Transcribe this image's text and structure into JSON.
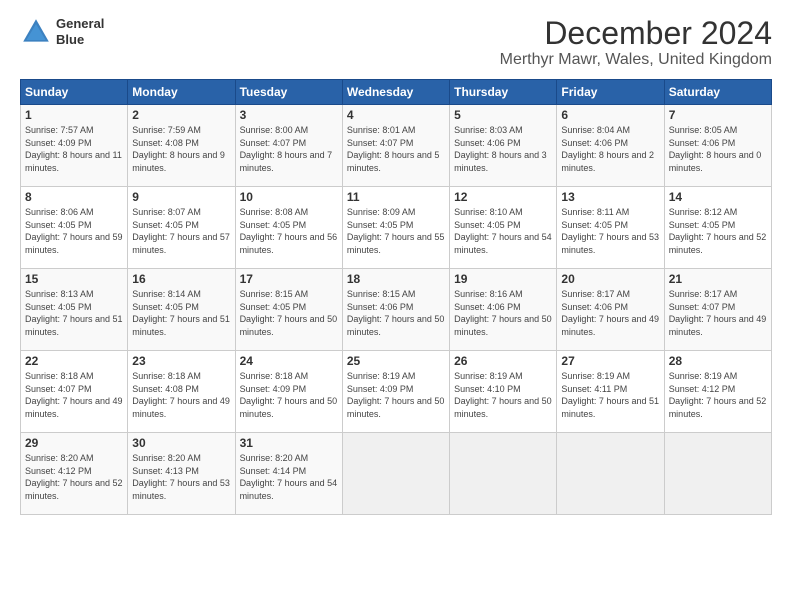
{
  "logo": {
    "line1": "General",
    "line2": "Blue"
  },
  "title": "December 2024",
  "location": "Merthyr Mawr, Wales, United Kingdom",
  "weekdays": [
    "Sunday",
    "Monday",
    "Tuesday",
    "Wednesday",
    "Thursday",
    "Friday",
    "Saturday"
  ],
  "weeks": [
    [
      {
        "day": "1",
        "sunrise": "7:57 AM",
        "sunset": "4:09 PM",
        "daylight": "8 hours and 11 minutes."
      },
      {
        "day": "2",
        "sunrise": "7:59 AM",
        "sunset": "4:08 PM",
        "daylight": "8 hours and 9 minutes."
      },
      {
        "day": "3",
        "sunrise": "8:00 AM",
        "sunset": "4:07 PM",
        "daylight": "8 hours and 7 minutes."
      },
      {
        "day": "4",
        "sunrise": "8:01 AM",
        "sunset": "4:07 PM",
        "daylight": "8 hours and 5 minutes."
      },
      {
        "day": "5",
        "sunrise": "8:03 AM",
        "sunset": "4:06 PM",
        "daylight": "8 hours and 3 minutes."
      },
      {
        "day": "6",
        "sunrise": "8:04 AM",
        "sunset": "4:06 PM",
        "daylight": "8 hours and 2 minutes."
      },
      {
        "day": "7",
        "sunrise": "8:05 AM",
        "sunset": "4:06 PM",
        "daylight": "8 hours and 0 minutes."
      }
    ],
    [
      {
        "day": "8",
        "sunrise": "8:06 AM",
        "sunset": "4:05 PM",
        "daylight": "7 hours and 59 minutes."
      },
      {
        "day": "9",
        "sunrise": "8:07 AM",
        "sunset": "4:05 PM",
        "daylight": "7 hours and 57 minutes."
      },
      {
        "day": "10",
        "sunrise": "8:08 AM",
        "sunset": "4:05 PM",
        "daylight": "7 hours and 56 minutes."
      },
      {
        "day": "11",
        "sunrise": "8:09 AM",
        "sunset": "4:05 PM",
        "daylight": "7 hours and 55 minutes."
      },
      {
        "day": "12",
        "sunrise": "8:10 AM",
        "sunset": "4:05 PM",
        "daylight": "7 hours and 54 minutes."
      },
      {
        "day": "13",
        "sunrise": "8:11 AM",
        "sunset": "4:05 PM",
        "daylight": "7 hours and 53 minutes."
      },
      {
        "day": "14",
        "sunrise": "8:12 AM",
        "sunset": "4:05 PM",
        "daylight": "7 hours and 52 minutes."
      }
    ],
    [
      {
        "day": "15",
        "sunrise": "8:13 AM",
        "sunset": "4:05 PM",
        "daylight": "7 hours and 51 minutes."
      },
      {
        "day": "16",
        "sunrise": "8:14 AM",
        "sunset": "4:05 PM",
        "daylight": "7 hours and 51 minutes."
      },
      {
        "day": "17",
        "sunrise": "8:15 AM",
        "sunset": "4:05 PM",
        "daylight": "7 hours and 50 minutes."
      },
      {
        "day": "18",
        "sunrise": "8:15 AM",
        "sunset": "4:06 PM",
        "daylight": "7 hours and 50 minutes."
      },
      {
        "day": "19",
        "sunrise": "8:16 AM",
        "sunset": "4:06 PM",
        "daylight": "7 hours and 50 minutes."
      },
      {
        "day": "20",
        "sunrise": "8:17 AM",
        "sunset": "4:06 PM",
        "daylight": "7 hours and 49 minutes."
      },
      {
        "day": "21",
        "sunrise": "8:17 AM",
        "sunset": "4:07 PM",
        "daylight": "7 hours and 49 minutes."
      }
    ],
    [
      {
        "day": "22",
        "sunrise": "8:18 AM",
        "sunset": "4:07 PM",
        "daylight": "7 hours and 49 minutes."
      },
      {
        "day": "23",
        "sunrise": "8:18 AM",
        "sunset": "4:08 PM",
        "daylight": "7 hours and 49 minutes."
      },
      {
        "day": "24",
        "sunrise": "8:18 AM",
        "sunset": "4:09 PM",
        "daylight": "7 hours and 50 minutes."
      },
      {
        "day": "25",
        "sunrise": "8:19 AM",
        "sunset": "4:09 PM",
        "daylight": "7 hours and 50 minutes."
      },
      {
        "day": "26",
        "sunrise": "8:19 AM",
        "sunset": "4:10 PM",
        "daylight": "7 hours and 50 minutes."
      },
      {
        "day": "27",
        "sunrise": "8:19 AM",
        "sunset": "4:11 PM",
        "daylight": "7 hours and 51 minutes."
      },
      {
        "day": "28",
        "sunrise": "8:19 AM",
        "sunset": "4:12 PM",
        "daylight": "7 hours and 52 minutes."
      }
    ],
    [
      {
        "day": "29",
        "sunrise": "8:20 AM",
        "sunset": "4:12 PM",
        "daylight": "7 hours and 52 minutes."
      },
      {
        "day": "30",
        "sunrise": "8:20 AM",
        "sunset": "4:13 PM",
        "daylight": "7 hours and 53 minutes."
      },
      {
        "day": "31",
        "sunrise": "8:20 AM",
        "sunset": "4:14 PM",
        "daylight": "7 hours and 54 minutes."
      },
      null,
      null,
      null,
      null
    ]
  ]
}
